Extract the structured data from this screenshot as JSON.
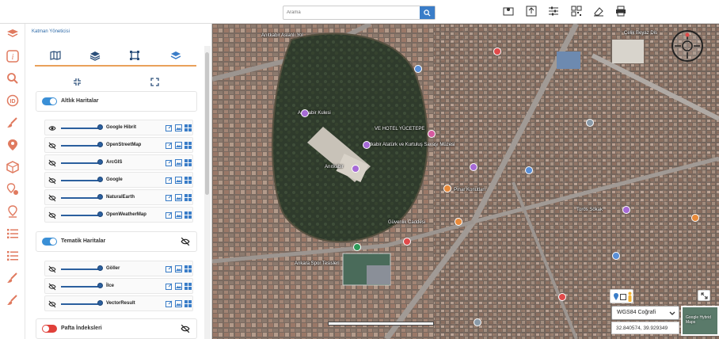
{
  "search": {
    "placeholder": "Arama"
  },
  "toolbar": {
    "icons": [
      "map-pin-icon",
      "upload-icon",
      "sliders-icon",
      "qr-code-icon",
      "eraser-icon",
      "printer-icon"
    ]
  },
  "leftrail": {
    "icons": [
      "book-icon",
      "info-icon",
      "search-icon",
      "layers-id-icon",
      "brush-icon",
      "location-pin-icon",
      "cube-icon",
      "pin-settings-icon",
      "pin-marker-icon",
      "list-icon",
      "list-icon",
      "brush-icon",
      "brush-icon"
    ]
  },
  "panel": {
    "title": "Katman Yöneticisi",
    "tabs": [
      "map-icon",
      "layers-icon",
      "crop-icon",
      "layers-stack-icon"
    ],
    "tools": [
      "compress-icon",
      "expand-icon"
    ],
    "base_maps": {
      "label": "Altlık Haritalar",
      "enabled": true,
      "layers": [
        {
          "name": "Google Hibrit",
          "opacity": 1.0
        },
        {
          "name": "OpenStreetMap",
          "opacity": 1.0
        },
        {
          "name": "ArcGIS",
          "opacity": 1.0
        },
        {
          "name": "Google",
          "opacity": 1.0
        },
        {
          "name": "NaturalEarth",
          "opacity": 1.0
        },
        {
          "name": "OpenWeatherMap",
          "opacity": 1.0
        }
      ]
    },
    "thematic_maps": {
      "label": "Tematik Haritalar",
      "enabled": true,
      "layers": [
        {
          "name": "Göller",
          "opacity": 1.0
        },
        {
          "name": "İlce",
          "opacity": 1.0
        },
        {
          "name": "VectorResult",
          "opacity": 1.0
        }
      ]
    },
    "sheet_index": {
      "label": "Pafta İndeksleri",
      "enabled": false
    }
  },
  "map": {
    "labels": [
      "Anıtkabir Aslanlı Yol",
      "Anıtkabir Atatürk ve Kurtuluş Savaşı Müzesi",
      "Anıtkabir",
      "VE HOTEL YÜCETEPE",
      "Anıtkabir Kulesi",
      "Çelik Beyaz Dis",
      "Ankara Spor Tesisleri",
      "Pınar Konutları",
      "Güvenlik Caddesi",
      "Toros Sokak"
    ],
    "crs": "WGS84 Coğrafi",
    "coordinates": "32.840574, 39.929349",
    "minimap_label": "Google Hybrid Maps"
  },
  "colors": {
    "accent": "#e9a15a",
    "primary": "#3a7dc8",
    "toggle_on": "#3a8fd6",
    "toggle_off": "#e0403a"
  }
}
